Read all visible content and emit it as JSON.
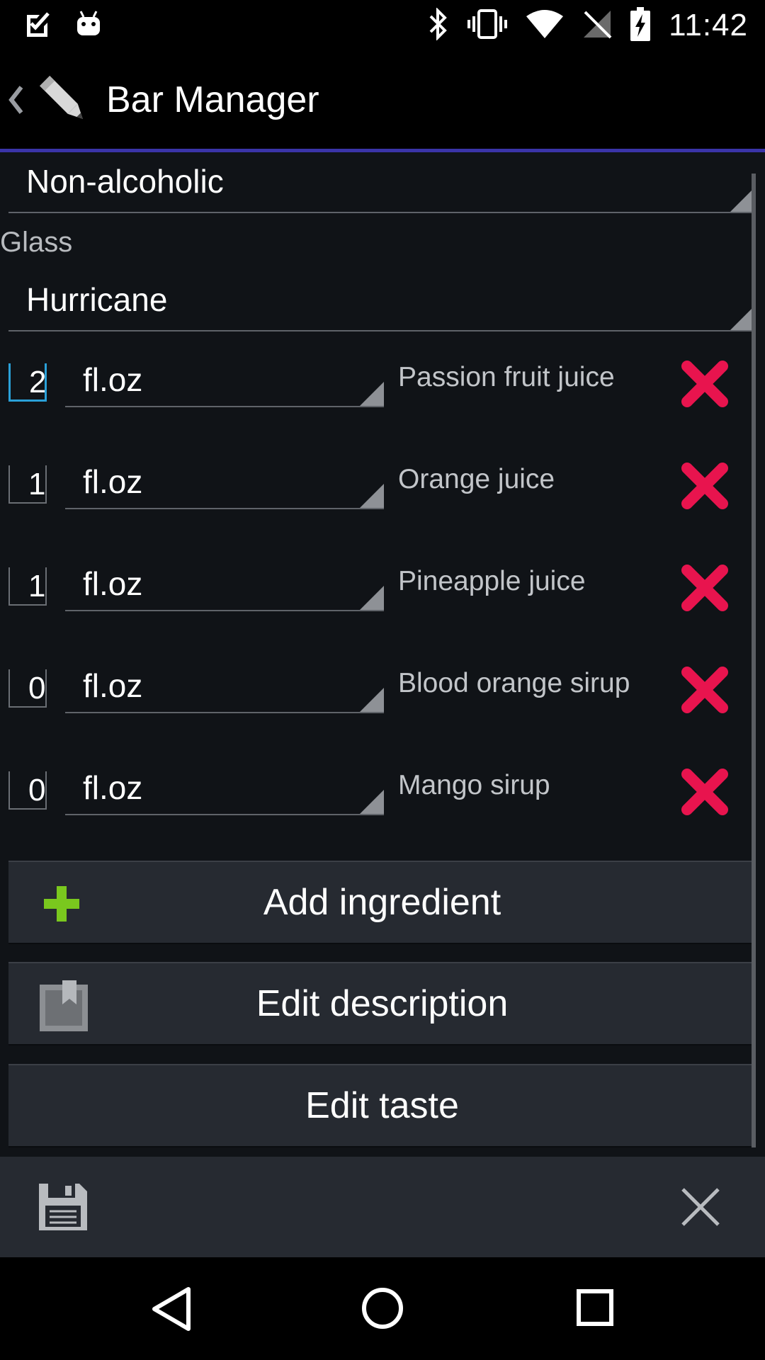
{
  "status_bar": {
    "time": "11:42",
    "left_icons": [
      "checklist-icon",
      "android-icon"
    ],
    "right_icons": [
      "bluetooth-icon",
      "vibrate-icon",
      "wifi-icon",
      "no-sim-icon",
      "battery-charging-icon"
    ]
  },
  "action_bar": {
    "title": "Bar Manager",
    "back_icon": "chevron-left-icon",
    "logo_icon": "pencil-icon"
  },
  "form": {
    "category_value": "Non-alcoholic",
    "glass_label": "Glass",
    "glass_value": "Hurricane"
  },
  "ingredients": [
    {
      "qty": "2",
      "unit": "fl.oz",
      "name": "Passion fruit juice"
    },
    {
      "qty": "1",
      "unit": "fl.oz",
      "name": "Orange juice"
    },
    {
      "qty": "1",
      "unit": "fl.oz",
      "name": "Pineapple juice"
    },
    {
      "qty": "0",
      "unit": "fl.oz",
      "name": "Blood orange sirup"
    },
    {
      "qty": "0",
      "unit": "fl.oz",
      "name": "Mango sirup"
    }
  ],
  "buttons": {
    "add_ingredient": "Add ingredient",
    "edit_description": "Edit description",
    "edit_taste": "Edit taste"
  },
  "bottom_bar": {
    "save_icon": "save-icon",
    "close_icon": "close-icon"
  },
  "nav_bar": {
    "back_icon": "nav-back-icon",
    "home_icon": "nav-home-icon",
    "recents_icon": "nav-recents-icon"
  },
  "colors": {
    "accent_line": "#3a34a8",
    "delete_x": "#e8144e",
    "add_plus": "#7ac81e",
    "focus": "#2aa0d8"
  }
}
